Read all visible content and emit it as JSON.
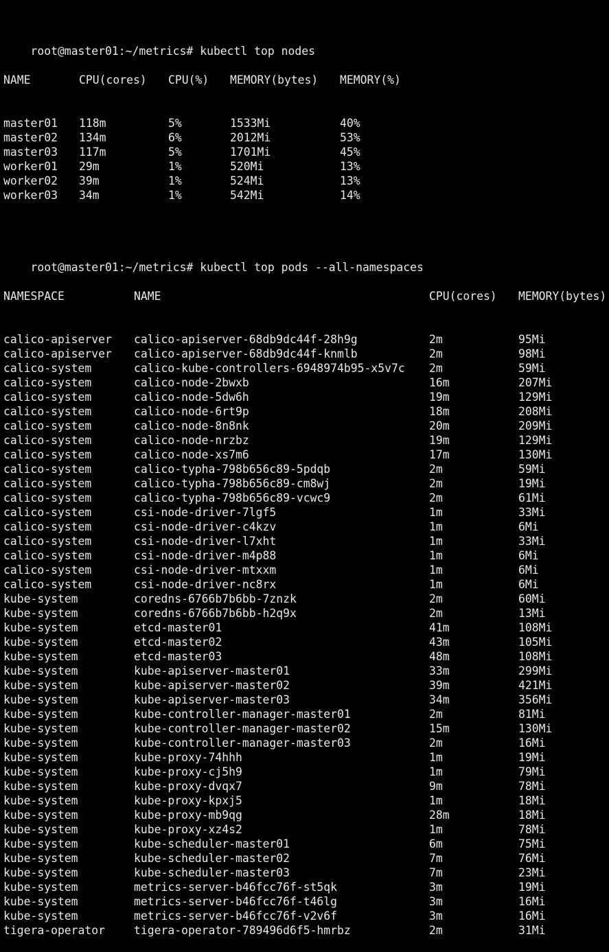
{
  "prompt": "root@master01:~/metrics#",
  "commands": {
    "top_nodes": "kubectl top nodes",
    "top_pods": "kubectl top pods --all-namespaces"
  },
  "nodes": {
    "headers": [
      "NAME",
      "CPU(cores)",
      "CPU(%)",
      "MEMORY(bytes)",
      "MEMORY(%)"
    ],
    "rows": [
      [
        "master01",
        "118m",
        "5%",
        "1533Mi",
        "40%"
      ],
      [
        "master02",
        "134m",
        "6%",
        "2012Mi",
        "53%"
      ],
      [
        "master03",
        "117m",
        "5%",
        "1701Mi",
        "45%"
      ],
      [
        "worker01",
        "29m",
        "1%",
        "520Mi",
        "13%"
      ],
      [
        "worker02",
        "39m",
        "1%",
        "524Mi",
        "13%"
      ],
      [
        "worker03",
        "34m",
        "1%",
        "542Mi",
        "14%"
      ]
    ]
  },
  "pods": {
    "headers": [
      "NAMESPACE",
      "NAME",
      "CPU(cores)",
      "MEMORY(bytes)"
    ],
    "rows": [
      [
        "calico-apiserver",
        "calico-apiserver-68db9dc44f-28h9g",
        "2m",
        "95Mi"
      ],
      [
        "calico-apiserver",
        "calico-apiserver-68db9dc44f-knmlb",
        "2m",
        "98Mi"
      ],
      [
        "calico-system",
        "calico-kube-controllers-6948974b95-x5v7c",
        "2m",
        "59Mi"
      ],
      [
        "calico-system",
        "calico-node-2bwxb",
        "16m",
        "207Mi"
      ],
      [
        "calico-system",
        "calico-node-5dw6h",
        "19m",
        "129Mi"
      ],
      [
        "calico-system",
        "calico-node-6rt9p",
        "18m",
        "208Mi"
      ],
      [
        "calico-system",
        "calico-node-8n8nk",
        "20m",
        "209Mi"
      ],
      [
        "calico-system",
        "calico-node-nrzbz",
        "19m",
        "129Mi"
      ],
      [
        "calico-system",
        "calico-node-xs7m6",
        "17m",
        "130Mi"
      ],
      [
        "calico-system",
        "calico-typha-798b656c89-5pdqb",
        "2m",
        "59Mi"
      ],
      [
        "calico-system",
        "calico-typha-798b656c89-cm8wj",
        "2m",
        "19Mi"
      ],
      [
        "calico-system",
        "calico-typha-798b656c89-vcwc9",
        "2m",
        "61Mi"
      ],
      [
        "calico-system",
        "csi-node-driver-7lgf5",
        "1m",
        "33Mi"
      ],
      [
        "calico-system",
        "csi-node-driver-c4kzv",
        "1m",
        "6Mi"
      ],
      [
        "calico-system",
        "csi-node-driver-l7xht",
        "1m",
        "33Mi"
      ],
      [
        "calico-system",
        "csi-node-driver-m4p88",
        "1m",
        "6Mi"
      ],
      [
        "calico-system",
        "csi-node-driver-mtxxm",
        "1m",
        "6Mi"
      ],
      [
        "calico-system",
        "csi-node-driver-nc8rx",
        "1m",
        "6Mi"
      ],
      [
        "kube-system",
        "coredns-6766b7b6bb-7znzk",
        "2m",
        "60Mi"
      ],
      [
        "kube-system",
        "coredns-6766b7b6bb-h2q9x",
        "2m",
        "13Mi"
      ],
      [
        "kube-system",
        "etcd-master01",
        "41m",
        "108Mi"
      ],
      [
        "kube-system",
        "etcd-master02",
        "43m",
        "105Mi"
      ],
      [
        "kube-system",
        "etcd-master03",
        "48m",
        "108Mi"
      ],
      [
        "kube-system",
        "kube-apiserver-master01",
        "33m",
        "299Mi"
      ],
      [
        "kube-system",
        "kube-apiserver-master02",
        "39m",
        "421Mi"
      ],
      [
        "kube-system",
        "kube-apiserver-master03",
        "34m",
        "356Mi"
      ],
      [
        "kube-system",
        "kube-controller-manager-master01",
        "2m",
        "81Mi"
      ],
      [
        "kube-system",
        "kube-controller-manager-master02",
        "15m",
        "130Mi"
      ],
      [
        "kube-system",
        "kube-controller-manager-master03",
        "2m",
        "16Mi"
      ],
      [
        "kube-system",
        "kube-proxy-74hhh",
        "1m",
        "19Mi"
      ],
      [
        "kube-system",
        "kube-proxy-cj5h9",
        "1m",
        "79Mi"
      ],
      [
        "kube-system",
        "kube-proxy-dvqx7",
        "9m",
        "78Mi"
      ],
      [
        "kube-system",
        "kube-proxy-kpxj5",
        "1m",
        "18Mi"
      ],
      [
        "kube-system",
        "kube-proxy-mb9qg",
        "28m",
        "18Mi"
      ],
      [
        "kube-system",
        "kube-proxy-xz4s2",
        "1m",
        "78Mi"
      ],
      [
        "kube-system",
        "kube-scheduler-master01",
        "6m",
        "75Mi"
      ],
      [
        "kube-system",
        "kube-scheduler-master02",
        "7m",
        "76Mi"
      ],
      [
        "kube-system",
        "kube-scheduler-master03",
        "7m",
        "23Mi"
      ],
      [
        "kube-system",
        "metrics-server-b46fcc76f-st5qk",
        "3m",
        "19Mi"
      ],
      [
        "kube-system",
        "metrics-server-b46fcc76f-t46lg",
        "3m",
        "16Mi"
      ],
      [
        "kube-system",
        "metrics-server-b46fcc76f-v2v6f",
        "3m",
        "16Mi"
      ],
      [
        "tigera-operator",
        "tigera-operator-789496d6f5-hmrbz",
        "2m",
        "31Mi"
      ]
    ]
  },
  "colors": {
    "background": "#000000",
    "foreground": "#e8e8e8"
  }
}
